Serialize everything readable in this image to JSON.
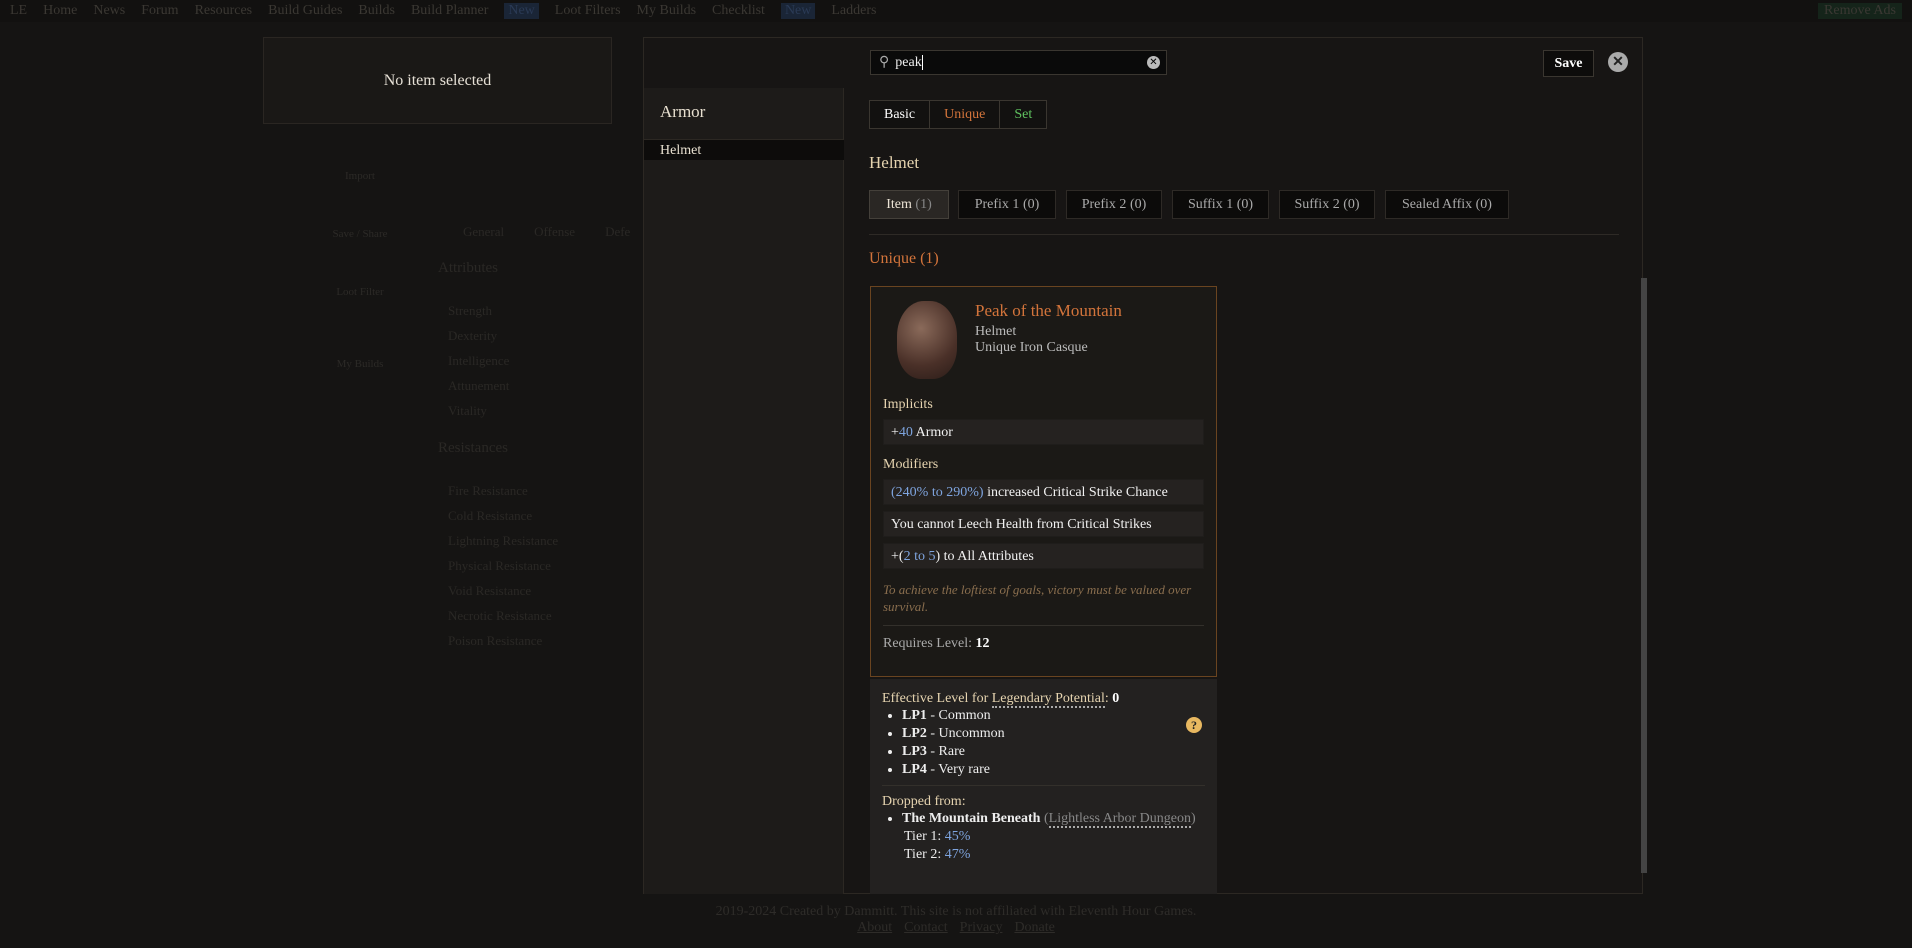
{
  "nav": {
    "logo": "LE",
    "items": [
      "Home",
      "News",
      "Forum",
      "Resources",
      "Build Guides",
      "Builds",
      "Build Planner"
    ],
    "new_badge": "New",
    "items2": [
      "Loot Filters",
      "My Builds",
      "Checklist"
    ],
    "items3": [
      "Ladders"
    ],
    "remove_ads": "Remove Ads"
  },
  "left_panel": {
    "no_item": "No item selected"
  },
  "side_tools": [
    "Import",
    "Save / Share",
    "Loot Filter",
    "My Builds"
  ],
  "bg_tabs": [
    "General",
    "Offense",
    "Defe"
  ],
  "bg_sections": {
    "attributes": "Attributes",
    "attr_items": [
      "Strength",
      "Dexterity",
      "Intelligence",
      "Attunement",
      "Vitality"
    ],
    "resistances": "Resistances",
    "res_items": [
      "Fire Resistance",
      "Cold Resistance",
      "Lightning Resistance",
      "Physical Resistance",
      "Void Resistance",
      "Necrotic Resistance",
      "Poison Resistance"
    ]
  },
  "modal": {
    "search": {
      "value": "peak",
      "icon": "search-icon"
    },
    "save_label": "Save",
    "category": "Armor",
    "subcategory": "Helmet",
    "rarity_tabs": [
      {
        "label": "Basic",
        "color": "#ffffff"
      },
      {
        "label": "Unique",
        "color": "#d3743b"
      },
      {
        "label": "Set",
        "color": "#5fc25f"
      }
    ],
    "slot_title": "Helmet",
    "affix_tabs": [
      {
        "label": "Item",
        "count": "(1)"
      },
      {
        "label": "Prefix 1",
        "count": "(0)"
      },
      {
        "label": "Prefix 2",
        "count": "(0)"
      },
      {
        "label": "Suffix 1",
        "count": "(0)"
      },
      {
        "label": "Suffix 2",
        "count": "(0)"
      },
      {
        "label": "Sealed Affix",
        "count": "(0)"
      }
    ],
    "results_heading": "Unique (1)",
    "item": {
      "name": "Peak of the Mountain",
      "type": "Helmet",
      "base": "Unique Iron Casque",
      "implicits_label": "Implicits",
      "implicit": {
        "plus": "+",
        "value": "40",
        "text": " Armor"
      },
      "modifiers_label": "Modifiers",
      "mod1": {
        "open": "(",
        "a": "240%",
        "to": " to ",
        "b": "290%",
        "close": ")",
        "text": " increased Critical Strike Chance"
      },
      "mod2": "You cannot Leech Health from Critical Strikes",
      "mod3": {
        "open": "+(",
        "a": "2",
        "to": " to ",
        "b": "5",
        "close": ")",
        "text": " to All Attributes"
      },
      "lore": "To achieve the loftiest of goals, victory must be valued over survival.",
      "req_label": "Requires Level: ",
      "req_level": "12"
    },
    "info": {
      "eff_prefix": "Effective Level for ",
      "eff_link": "Legendary Potential",
      "eff_sep": ": ",
      "eff_value": "0",
      "lp": [
        {
          "k": "LP1",
          "v": " - Common"
        },
        {
          "k": "LP2",
          "v": " - Uncommon"
        },
        {
          "k": "LP3",
          "v": " - Rare"
        },
        {
          "k": "LP4",
          "v": " - Very rare"
        }
      ],
      "dropped_label": "Dropped from:",
      "source": "The Mountain Beneath",
      "source_loc": "Lightless Arbor Dungeon",
      "tiers": [
        {
          "label": "Tier 1: ",
          "value": "45%"
        },
        {
          "label": "Tier 2: ",
          "value": "47%"
        }
      ]
    }
  },
  "footer": {
    "text": "2019-2024 Created by Dammitt. This site is not affiliated with Eleventh Hour Games.",
    "links": [
      "About",
      "Contact",
      "Privacy",
      "Donate"
    ]
  }
}
